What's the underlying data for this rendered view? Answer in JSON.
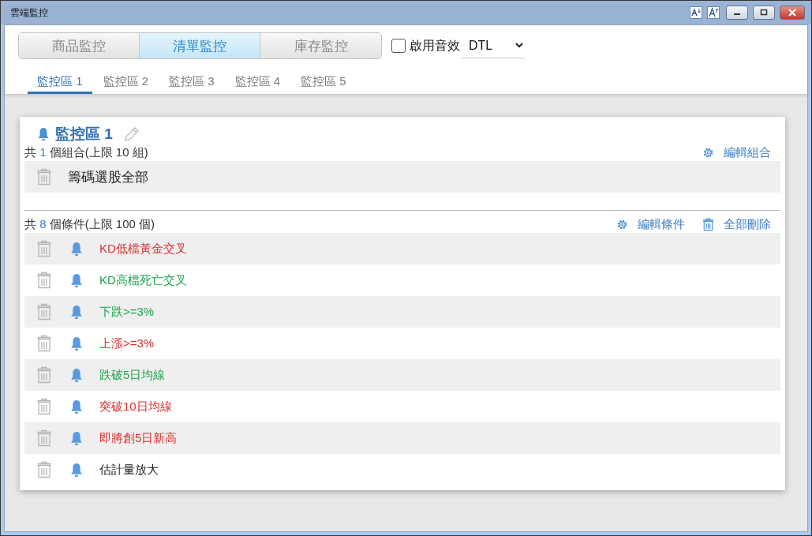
{
  "window": {
    "title": "雲端監控"
  },
  "modes": [
    {
      "label": "商品監控",
      "selected": false
    },
    {
      "label": "清單監控",
      "selected": true
    },
    {
      "label": "庫存監控",
      "selected": false
    }
  ],
  "sound": {
    "label": "啟用音效",
    "checked": false
  },
  "source_select": {
    "value": "DTL"
  },
  "zone_tabs": [
    {
      "label": "監控區 1",
      "selected": true
    },
    {
      "label": "監控區 2",
      "selected": false
    },
    {
      "label": "監控區 3",
      "selected": false
    },
    {
      "label": "監控區 4",
      "selected": false
    },
    {
      "label": "監控區 5",
      "selected": false
    }
  ],
  "zone": {
    "title": "監控區 1",
    "groups": {
      "count_prefix": "共",
      "count": "1",
      "count_suffix": "個組合(上限 10 組)",
      "edit_label": "編輯組合",
      "items": [
        "籌碼選股全部"
      ]
    },
    "conditions": {
      "count_prefix": "共",
      "count": "8",
      "count_suffix": "個條件(上限 100 個)",
      "edit_label": "編輯條件",
      "delete_all_label": "全部刪除",
      "items": [
        {
          "label": "KD低檔黃金交叉",
          "color": "#d9302f"
        },
        {
          "label": "KD高檔死亡交叉",
          "color": "#1fa34a"
        },
        {
          "label": "下跌>=3%",
          "color": "#1fa34a"
        },
        {
          "label": "上漲>=3%",
          "color": "#d9302f"
        },
        {
          "label": "跌破5日均線",
          "color": "#1fa34a"
        },
        {
          "label": "突破10日均線",
          "color": "#d9302f"
        },
        {
          "label": "即將創5日新高",
          "color": "#d9302f"
        },
        {
          "label": "估計量放大",
          "color": "#222222"
        }
      ]
    }
  }
}
